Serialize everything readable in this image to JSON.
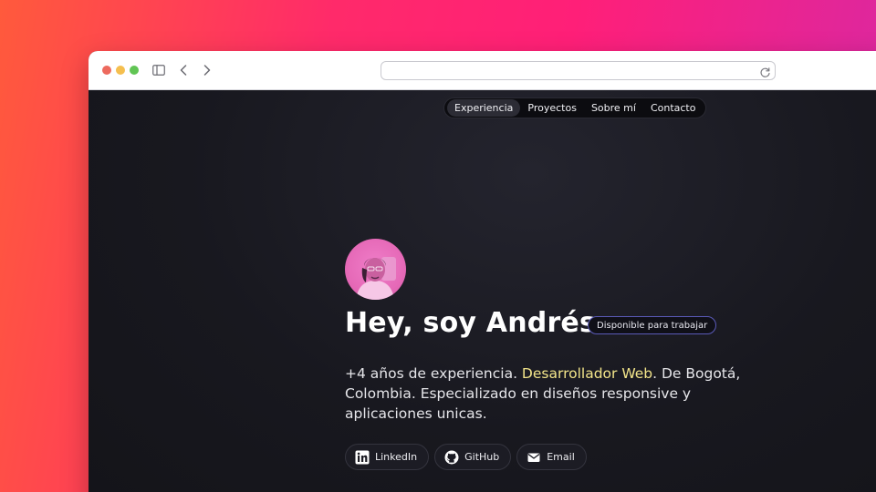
{
  "browser": {
    "url": "",
    "icons": [
      "sidebar-icon",
      "back-icon",
      "forward-icon",
      "reload-icon"
    ]
  },
  "nav": {
    "items": [
      {
        "label": "Experiencia",
        "active": true
      },
      {
        "label": "Proyectos",
        "active": false
      },
      {
        "label": "Sobre mí",
        "active": false
      },
      {
        "label": "Contacto",
        "active": false
      }
    ]
  },
  "hero": {
    "title": "Hey, soy Andrés",
    "badge": "Disponible para trabajar",
    "bio_prefix": "+4 años de experiencia. ",
    "bio_highlight": "Desarrollador Web",
    "bio_suffix": ". De Bogotá, Colombia. Especializado en diseños responsive y aplicaciones unicas."
  },
  "socials": [
    {
      "label": "LinkedIn",
      "icon": "linkedin-icon"
    },
    {
      "label": "GitHub",
      "icon": "github-icon"
    },
    {
      "label": "Email",
      "icon": "email-icon"
    }
  ],
  "colors": {
    "highlight": "#f3e58a",
    "badge_border": "#5a5ab8",
    "avatar_bg": "#e66ab8"
  }
}
